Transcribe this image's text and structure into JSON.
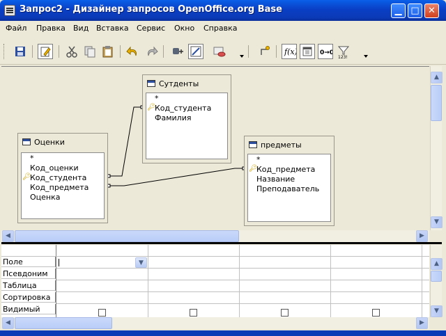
{
  "window": {
    "title": "Запрос2 - Дизайнер запросов OpenOffice.org Base"
  },
  "menu": [
    "Файл",
    "Правка",
    "Вид",
    "Вставка",
    "Сервис",
    "Окно",
    "Справка"
  ],
  "tables": {
    "students": {
      "title": "Сутденты",
      "fields": [
        "*",
        "Код_студента",
        "Фамилия"
      ],
      "key_field": "Код_студента"
    },
    "grades": {
      "title": "Оценки",
      "fields": [
        "*",
        "Код_оценки",
        "Код_студента",
        "Код_предмета",
        "Оценка"
      ],
      "key_field": "Код_студента"
    },
    "subjects": {
      "title": "предметы",
      "fields": [
        "*",
        "Код_предмета",
        "Название",
        "Преподаватель"
      ],
      "key_field": "Код_предмета"
    }
  },
  "grid": {
    "row_headers": [
      "Поле",
      "Псевдоним",
      "Таблица",
      "Сортировка",
      "Видимый"
    ]
  },
  "colors": {
    "title_bar": "#0A3FC5",
    "chrome": "#ECE9D8",
    "close_button": "#D1401E"
  }
}
